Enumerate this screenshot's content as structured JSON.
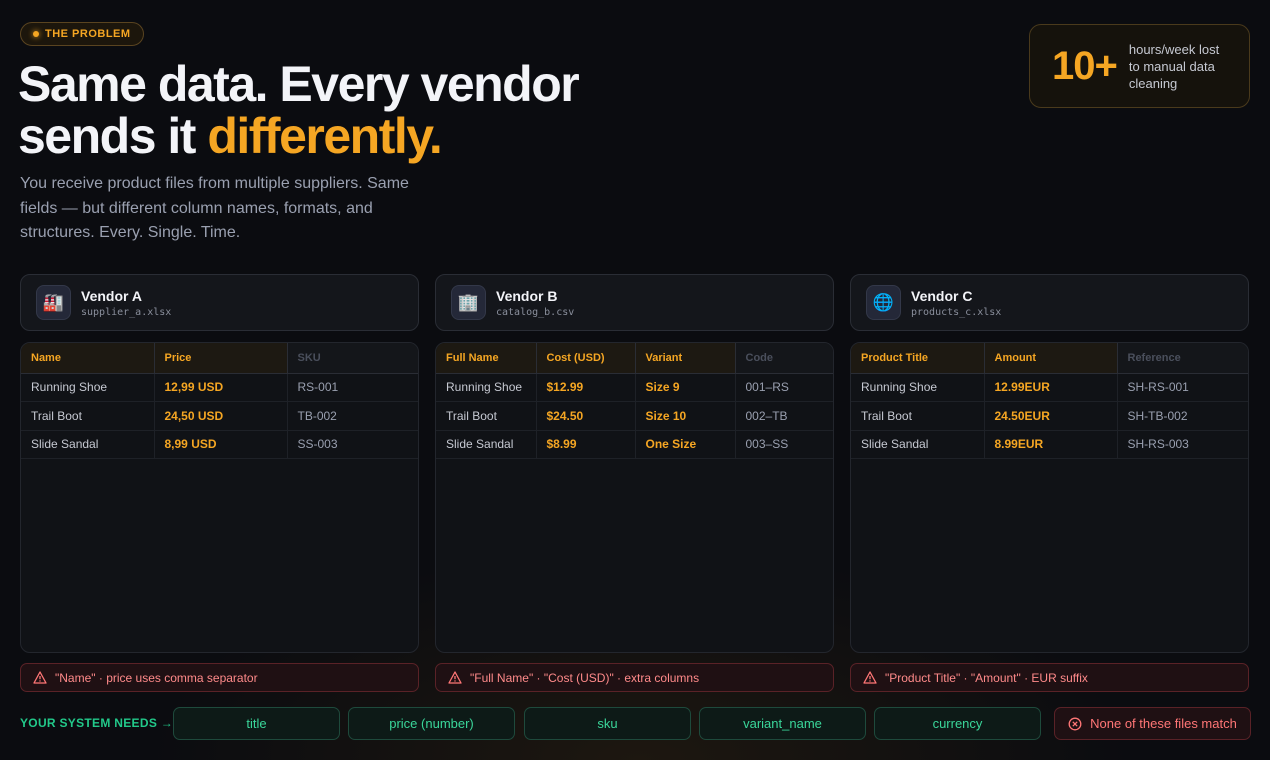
{
  "badge": {
    "label": "THE PROBLEM"
  },
  "headline": {
    "line1": "Same data. Every vendor",
    "line2_prefix": "sends it ",
    "line2_accent": "differently",
    "line2_suffix": "."
  },
  "subtitle": "You receive product files from multiple suppliers. Same fields — but different column names, formats, and structures. Every. Single. Time.",
  "stat": {
    "value": "10+",
    "label": "hours/week lost to manual data cleaning"
  },
  "colors": {
    "accent": "#f5a623",
    "success": "#3ad69a",
    "error": "#ff7676"
  },
  "vendors": [
    {
      "name": "Vendor A",
      "file": "supplier_a.xlsx",
      "icon": "factory-icon",
      "columns": [
        "Name",
        "Price",
        "SKU"
      ],
      "rows": [
        [
          "Running Shoe",
          "12,99 USD",
          "RS-001"
        ],
        [
          "Trail Boot",
          "24,50 USD",
          "TB-002"
        ],
        [
          "Slide Sandal",
          "8,99 USD",
          "SS-003"
        ]
      ],
      "warning": "\"Name\" · price uses comma separator"
    },
    {
      "name": "Vendor B",
      "file": "catalog_b.csv",
      "icon": "office-building-icon",
      "columns": [
        "Full Name",
        "Cost (USD)",
        "Variant",
        "Code"
      ],
      "rows": [
        [
          "Running Shoe",
          "$12.99",
          "Size 9",
          "001–RS"
        ],
        [
          "Trail Boot",
          "$24.50",
          "Size 10",
          "002–TB"
        ],
        [
          "Slide Sandal",
          "$8.99",
          "One Size",
          "003–SS"
        ]
      ],
      "warning": "\"Full Name\" · \"Cost (USD)\" · extra columns"
    },
    {
      "name": "Vendor C",
      "file": "products_c.xlsx",
      "icon": "globe-icon",
      "columns": [
        "Product Title",
        "Amount",
        "Reference"
      ],
      "rows": [
        [
          "Running Shoe",
          "12.99EUR",
          "SH-RS-001"
        ],
        [
          "Trail Boot",
          "24.50EUR",
          "SH-TB-002"
        ],
        [
          "Slide Sandal",
          "8.99EUR",
          "SH-RS-003"
        ]
      ],
      "warning": "\"Product Title\" · \"Amount\" · EUR suffix"
    }
  ],
  "system": {
    "label": "YOUR SYSTEM NEEDS →",
    "fields": [
      "title",
      "price (number)",
      "sku",
      "variant_name",
      "currency"
    ],
    "status": "None of these files match"
  }
}
